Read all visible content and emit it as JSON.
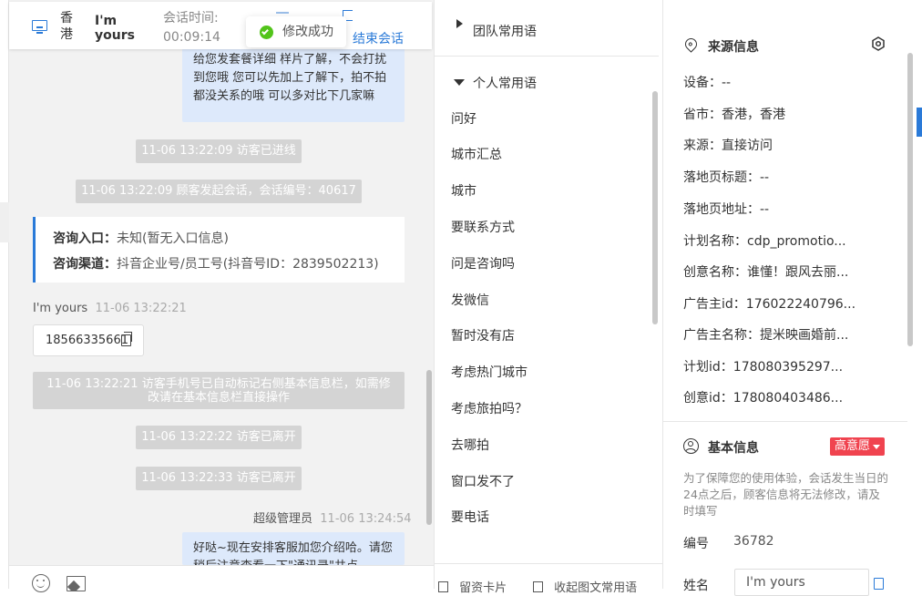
{
  "header": {
    "location_line1": "香",
    "location_line2": "港",
    "visitor_name_line1": "I'm",
    "visitor_name_line2": "yours",
    "session_time_label": "会话时间:",
    "session_time_value": "00:09:14",
    "end_session_label": "结束会话"
  },
  "toast": {
    "text": "修改成功"
  },
  "chat": {
    "top_bubble": "给您发套餐详细 样片了解，不会打扰到您哦 您可以先加上了解下，拍不拍都没关系的哦 可以多对比下几家嘛",
    "sys_visitor_in": "11-06 13:22:09 访客已进线",
    "sys_session_start": "11-06 13:22:09 顾客发起会话，会话编号：40617",
    "entry_label": "咨询入口：",
    "entry_value": "未知(暂无入口信息)",
    "channel_label": "咨询渠道：",
    "channel_value": "抖音企业号/员工号(抖音号ID：2839502213)",
    "visitor_name": "I'm yours",
    "visitor_time": "11-06 13:22:21",
    "visitor_phone": "18566335661",
    "sys_phone_note": "11-06 13:22:21 访客手机号已自动标记右侧基本信息栏，如需修改请在基本信息栏直接操作",
    "sys_left_1": "11-06 13:22:22 访客已离开",
    "sys_left_2": "11-06 13:22:33 访客已离开",
    "agent_name": "超级管理员",
    "agent_time": "11-06 13:24:54",
    "agent_bubble": "好哒~现在安排客服加您介绍哈。请您稍后注意查看一下\"通讯录\"共点"
  },
  "middle": {
    "team_phrases_label": "团队常用语",
    "personal_phrases_label": "个人常用语",
    "phrases": [
      "问好",
      "城市汇总",
      "城市",
      "要联系方式",
      "问是咨询吗",
      "发微信",
      "暂时没有店",
      "考虑热门城市",
      "考虑旅拍吗？",
      "去哪拍",
      "窗口发不了",
      "要电话"
    ],
    "bottom_card": "留资卡片",
    "bottom_collapse": "收起图文常用语"
  },
  "right": {
    "source_title": "来源信息",
    "source_rows": [
      {
        "label": "设备：",
        "value": "--"
      },
      {
        "label": "省市：",
        "value": "香港，香港"
      },
      {
        "label": "来源：",
        "value": "直接访问"
      },
      {
        "label": "落地页标题：",
        "value": "--"
      },
      {
        "label": "落地页地址：",
        "value": "--"
      },
      {
        "label": "计划名称：",
        "value": "cdp_promotio..."
      },
      {
        "label": "创意名称：",
        "value": "谁懂！跟风去丽..."
      },
      {
        "label": "广告主id：",
        "value": "176022240796..."
      },
      {
        "label": "广告主名称：",
        "value": "提米映画婚前..."
      },
      {
        "label": "计划id：",
        "value": "178080395297..."
      },
      {
        "label": "创意id：",
        "value": "178080403486..."
      }
    ],
    "basic_title": "基本信息",
    "intent_badge": "高意愿",
    "notice": "为了保障您的使用体验，会话发生当日的24点之后，顾客信息将无法修改，请及时填写",
    "number_label": "编号",
    "number_value": "36782",
    "name_label": "姓名",
    "name_value": "I'm yours"
  },
  "colors": {
    "accent": "#2a7ad8",
    "success": "#52c41a",
    "badge_red": "#f0434f",
    "bubble": "#dde9fb",
    "system_msg": "#d4d4d4"
  }
}
